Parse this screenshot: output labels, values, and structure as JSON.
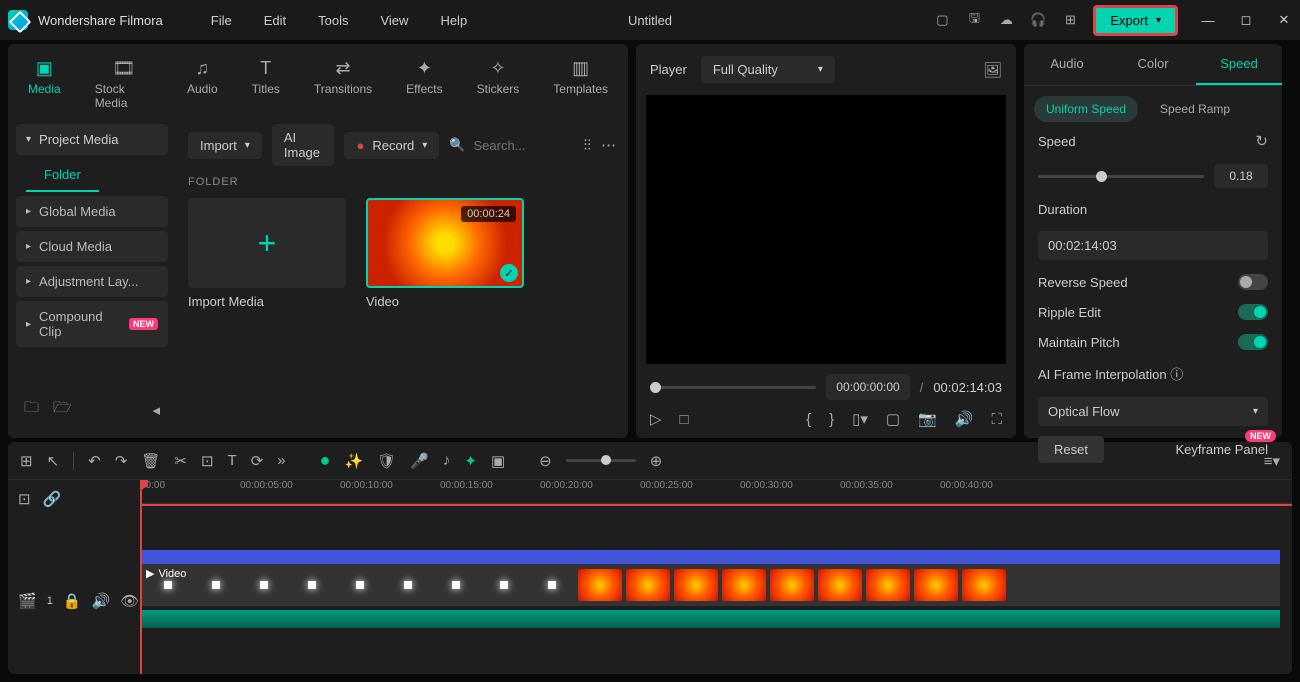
{
  "app": {
    "name": "Wondershare Filmora",
    "title": "Untitled"
  },
  "menu": {
    "file": "File",
    "edit": "Edit",
    "tools": "Tools",
    "view": "View",
    "help": "Help"
  },
  "export": {
    "label": "Export"
  },
  "toolTabs": {
    "media": "Media",
    "stockMedia": "Stock Media",
    "audio": "Audio",
    "titles": "Titles",
    "transitions": "Transitions",
    "effects": "Effects",
    "stickers": "Stickers",
    "templates": "Templates"
  },
  "sidebar": {
    "projectMedia": "Project Media",
    "folder": "Folder",
    "globalMedia": "Global Media",
    "cloudMedia": "Cloud Media",
    "adjustment": "Adjustment Lay...",
    "compound": "Compound Clip",
    "newBadge": "NEW"
  },
  "contentBar": {
    "import": "Import",
    "aiImage": "AI Image",
    "record": "Record",
    "searchPlaceholder": "Search..."
  },
  "folder": {
    "label": "FOLDER",
    "importMedia": "Import Media",
    "video": "Video",
    "videoDur": "00:00:24"
  },
  "player": {
    "label": "Player",
    "quality": "Full Quality",
    "pos": "00:00:00:00",
    "total": "00:02:14:03"
  },
  "rightTabs": {
    "audio": "Audio",
    "color": "Color",
    "speed": "Speed"
  },
  "speedSub": {
    "uniform": "Uniform Speed",
    "ramp": "Speed Ramp"
  },
  "speed": {
    "speedLabel": "Speed",
    "speedVal": "0.18",
    "durLabel": "Duration",
    "durVal": "00:02:14:03",
    "reverse": "Reverse Speed",
    "ripple": "Ripple Edit",
    "pitch": "Maintain Pitch",
    "aiInterp": "AI Frame Interpolation",
    "optical": "Optical Flow"
  },
  "footer": {
    "reset": "Reset",
    "keyframe": "Keyframe Panel",
    "new": "NEW"
  },
  "ruler": [
    "00:00",
    "00:00:05:00",
    "00:00:10:00",
    "00:00:15:00",
    "00:00:20:00",
    "00:00:25:00",
    "00:00:30:00",
    "00:00:35:00",
    "00:00:40:00"
  ],
  "clip": {
    "label": "Video"
  },
  "trackInfo": {
    "num": "1"
  }
}
